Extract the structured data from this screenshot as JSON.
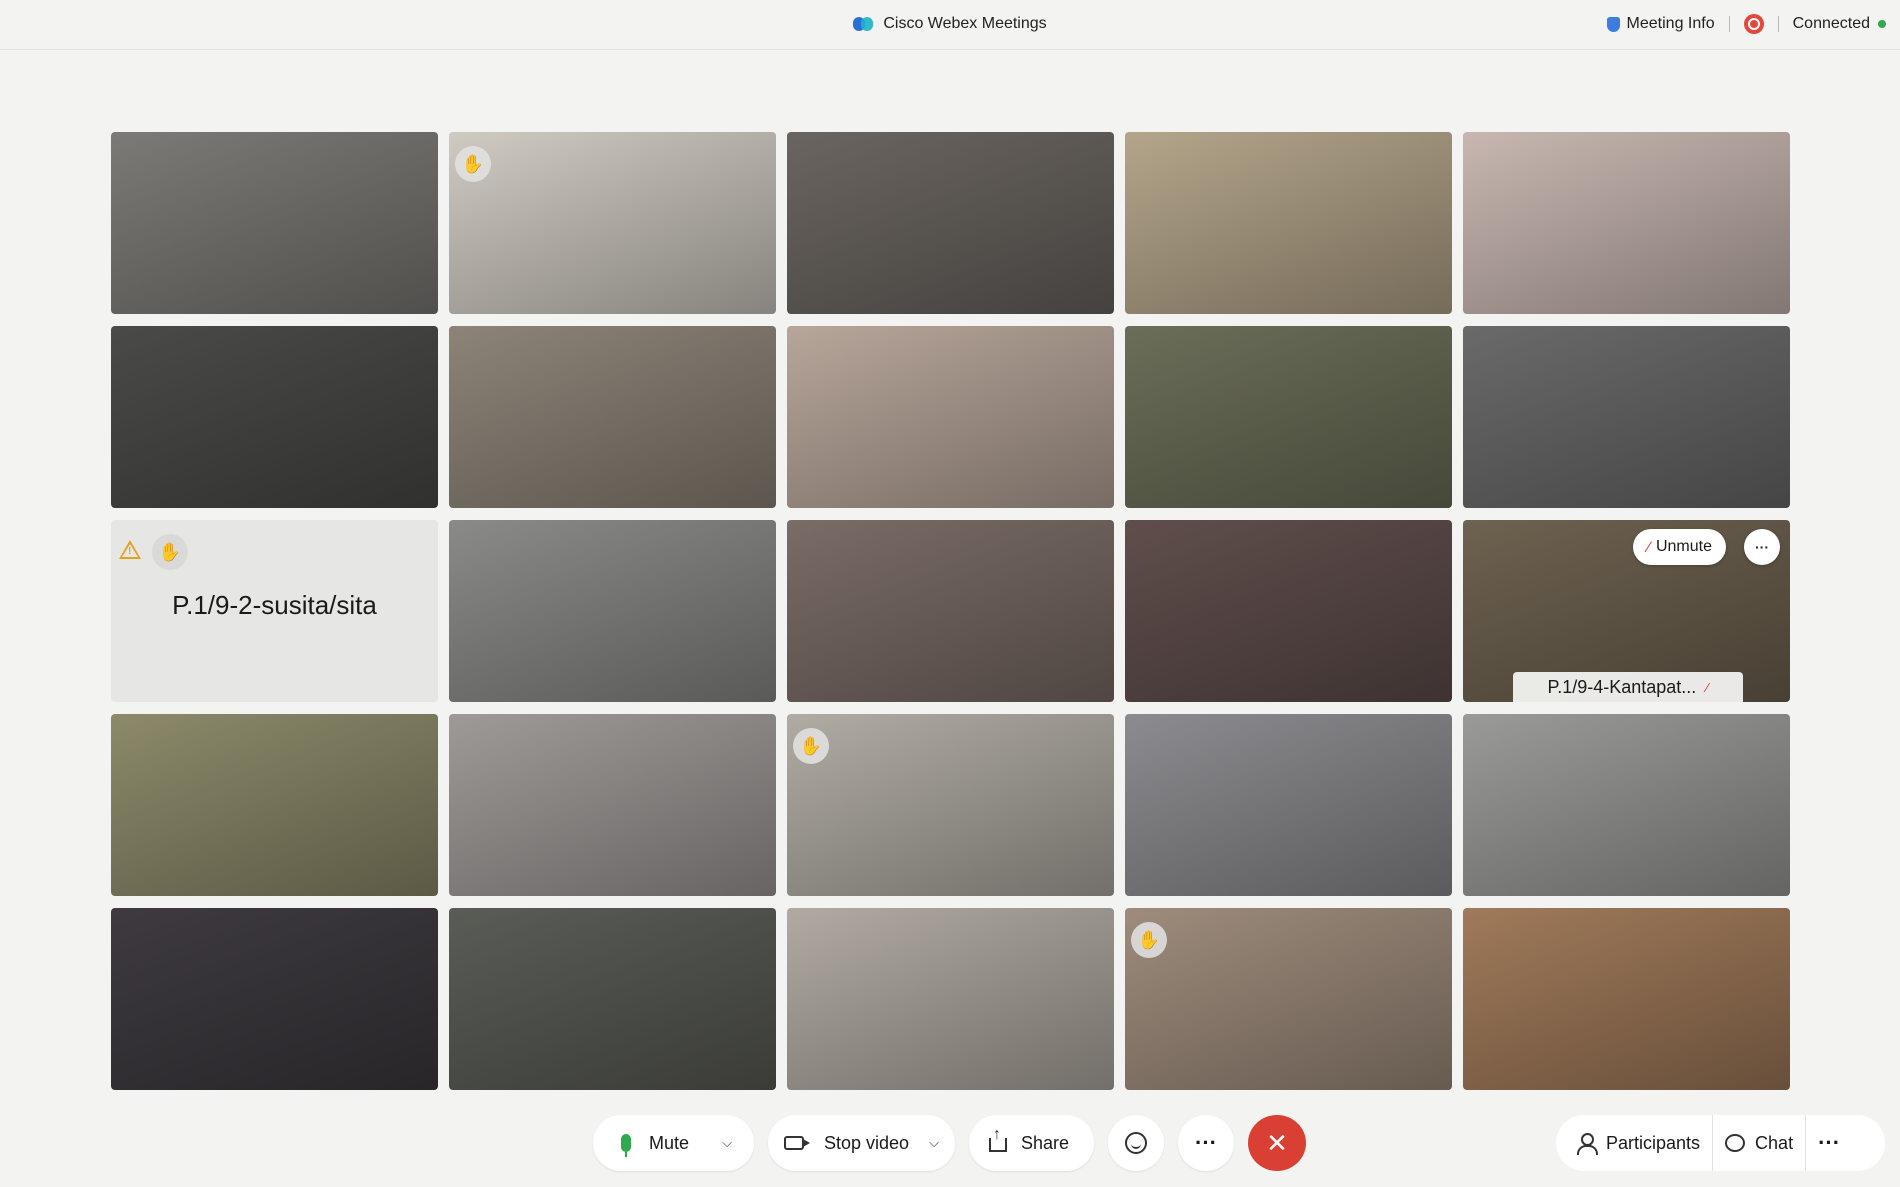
{
  "titlebar": {
    "app_title": "Cisco Webex Meetings",
    "meeting_info": "Meeting Info",
    "status": "Connected",
    "status_color": "#2fa84f",
    "record_color": "#e2483b"
  },
  "grid": {
    "columns": 5,
    "rows": 5,
    "tiles": [
      {
        "name": "",
        "hand_raised": false,
        "bg": "#7c7a76"
      },
      {
        "name": "",
        "hand_raised": true,
        "bg": "#cfcac2"
      },
      {
        "name": "",
        "hand_raised": false,
        "bg": "#6a6560"
      },
      {
        "name": "",
        "hand_raised": false,
        "bg": "#b4a58a"
      },
      {
        "name": "",
        "hand_raised": false,
        "bg": "#c8b7b1"
      },
      {
        "name": "",
        "hand_raised": false,
        "bg": "#4a4a48"
      },
      {
        "name": "",
        "hand_raised": false,
        "bg": "#8d8478"
      },
      {
        "name": "",
        "hand_raised": false,
        "bg": "#b7a69a"
      },
      {
        "name": "",
        "hand_raised": false,
        "bg": "#6b6e58"
      },
      {
        "name": "",
        "hand_raised": false,
        "bg": "#6a6a6a"
      },
      {
        "name": "P.1/9-2-susita/sita",
        "hand_raised": true,
        "bg": "#e6e6e4",
        "placeholder": true,
        "warning": true
      },
      {
        "name": "",
        "hand_raised": false,
        "bg": "#8a8a88"
      },
      {
        "name": "",
        "hand_raised": false,
        "bg": "#7a6c66"
      },
      {
        "name": "",
        "hand_raised": false,
        "bg": "#5f4e4c"
      },
      {
        "name": "P.1/9-4-Kantapat...",
        "hand_raised": false,
        "bg": "#6e6250",
        "unmute": "Unmute",
        "name_tag": true
      },
      {
        "name": "",
        "hand_raised": false,
        "bg": "#8c8a6a"
      },
      {
        "name": "",
        "hand_raised": false,
        "bg": "#9e9a98"
      },
      {
        "name": "",
        "hand_raised": true,
        "bg": "#b0aca4"
      },
      {
        "name": "",
        "hand_raised": false,
        "bg": "#8c8c90"
      },
      {
        "name": "",
        "hand_raised": false,
        "bg": "#9a9a98"
      },
      {
        "name": "",
        "hand_raised": false,
        "bg": "#3e3a40"
      },
      {
        "name": "",
        "hand_raised": false,
        "bg": "#5a5c56"
      },
      {
        "name": "",
        "hand_raised": false,
        "bg": "#b0aaa2"
      },
      {
        "name": "",
        "hand_raised": true,
        "bg": "#9e8c7c"
      },
      {
        "name": "",
        "hand_raised": false,
        "bg": "#a07a5a"
      }
    ]
  },
  "controls": {
    "mute_label": "Mute",
    "stop_video_label": "Stop video",
    "share_label": "Share",
    "participants_label": "Participants",
    "chat_label": "Chat",
    "end_color": "#d93f33"
  }
}
